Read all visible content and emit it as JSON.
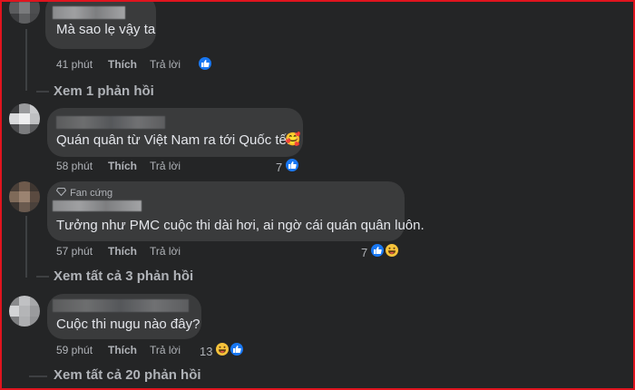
{
  "colors": {
    "background": "#242526",
    "bubble": "#3a3b3c",
    "text": "#e4e6eb",
    "muted": "#b0b3b8",
    "like_blue": "#1877f2",
    "frame_red": "#e0141e"
  },
  "comments": [
    {
      "text": "Mà sao lẹ vậy ta",
      "time": "41 phút",
      "like_label": "Thích",
      "reply_label": "Trả lời",
      "reaction_count": "",
      "reactions": [
        "like-icon"
      ]
    },
    {
      "text": "Quán quân từ Việt Nam ra tới Quốc tế.",
      "time": "58 phút",
      "like_label": "Thích",
      "reply_label": "Trả lời",
      "reaction_count": "7",
      "reactions": [
        "like-icon"
      ]
    },
    {
      "badge": "Fan cứng",
      "text": "Tưởng như PMC cuộc thi dài hơi, ai ngờ cái quán quân luôn.",
      "time": "57 phút",
      "like_label": "Thích",
      "reply_label": "Trả lời",
      "reaction_count": "7",
      "reactions": [
        "like-icon",
        "haha-icon"
      ]
    },
    {
      "text": "Cuộc thi nugu nào đây?",
      "time": "59 phút",
      "like_label": "Thích",
      "reply_label": "Trả lời",
      "reaction_count": "13",
      "reactions": [
        "haha-icon",
        "like-icon"
      ]
    }
  ],
  "view_replies": [
    "Xem 1 phản hồi",
    "Xem tất cả 3 phản hồi",
    "Xem tất cả 20 phản hồi"
  ]
}
